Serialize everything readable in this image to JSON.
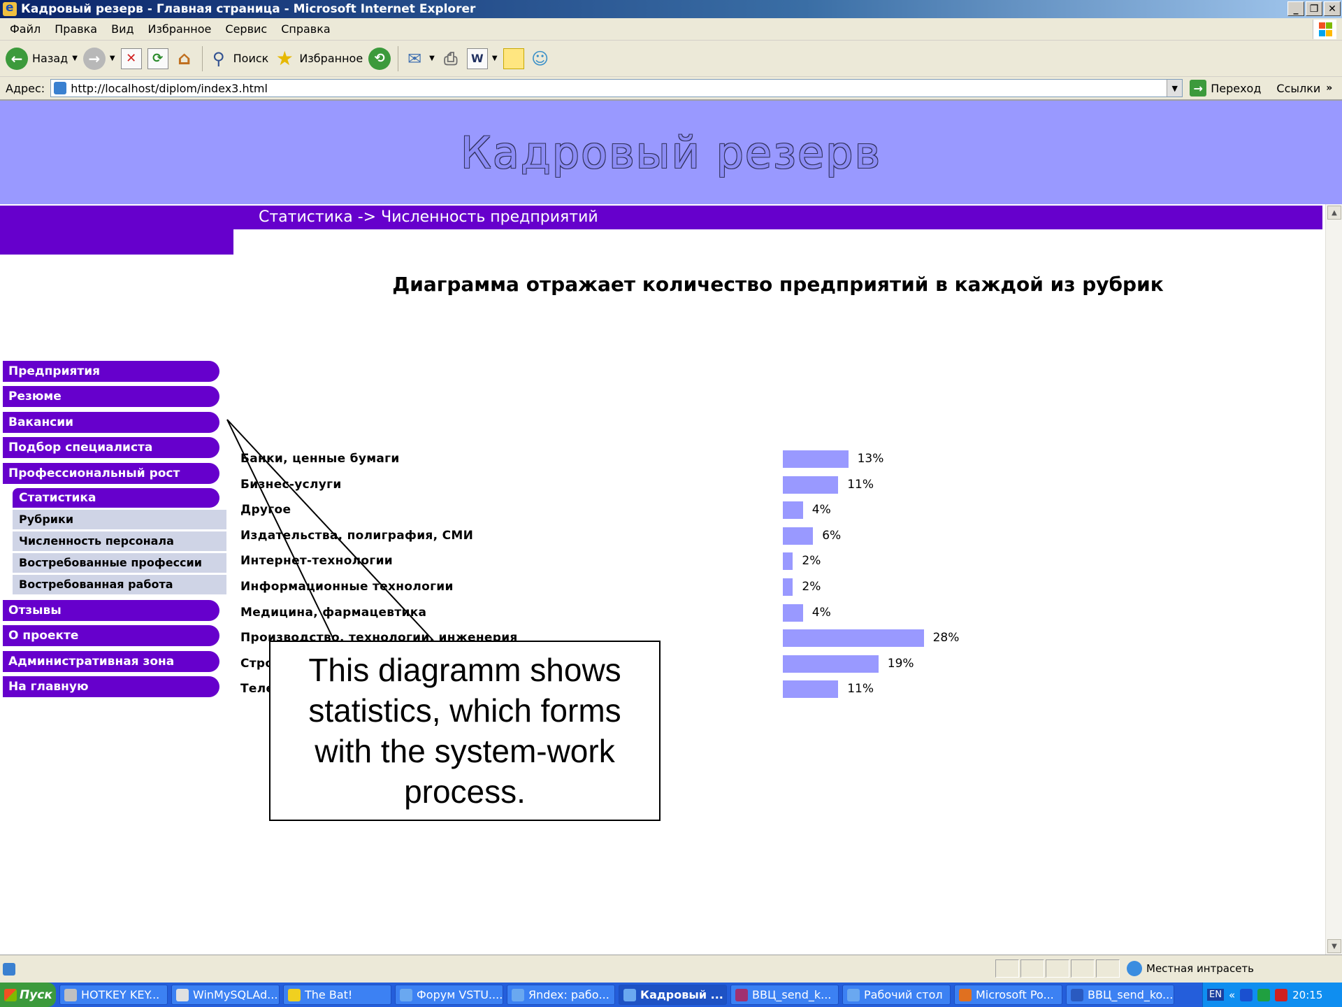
{
  "window": {
    "title": "Кадровый резерв - Главная страница - Microsoft Internet Explorer",
    "buttons": {
      "minimize": "_",
      "maximize": "❐",
      "close": "✕"
    }
  },
  "menu": [
    "Файл",
    "Правка",
    "Вид",
    "Избранное",
    "Сервис",
    "Справка"
  ],
  "toolbar": {
    "back": "Назад",
    "search": "Поиск",
    "favorites": "Избранное"
  },
  "address": {
    "label": "Адрес:",
    "url": "http://localhost/diplom/index3.html",
    "go": "Переход",
    "links": "Ссылки"
  },
  "page": {
    "banner_title": "Кадровый резерв",
    "breadcrumb": "Статистика -> Численность предприятий",
    "sidebar": {
      "items": [
        "Предприятия",
        "Резюме",
        "Вакансии",
        "Подбор специалиста",
        "Профессиональный рост"
      ],
      "active_sub": "Статистика",
      "subs": [
        "Рубрики",
        "Численность персонала",
        "Востребованные профессии",
        "Востребованная работа"
      ],
      "items_after": [
        "Отзывы",
        "О проекте",
        "Административная зона",
        "На главную"
      ]
    }
  },
  "chart_data": {
    "type": "bar",
    "orientation": "horizontal",
    "title": "Диаграмма отражает количество предприятий в каждой из рубрик",
    "categories": [
      "Банки, ценные бумаги",
      "Бизнес-услуги",
      "Другое",
      "Издательства, полиграфия, СМИ",
      "Интернет-технологии",
      "Информационные технологии",
      "Медицина, фармацевтика",
      "Производство, технологии, инженерия",
      "Строительство, недвижимость",
      "Телекоммуникации, связь"
    ],
    "values": [
      13,
      11,
      4,
      6,
      2,
      2,
      4,
      28,
      19,
      11
    ],
    "labels": [
      "13%",
      "11%",
      "4%",
      "6%",
      "2%",
      "2%",
      "4%",
      "28%",
      "19%",
      "11%"
    ],
    "unit": "%",
    "bar_color": "#9999ff"
  },
  "callout": {
    "text": "This diagramm shows statistics, which forms with the  system-work process."
  },
  "statusbar": {
    "zone": "Местная интрасеть"
  },
  "taskbar": {
    "start": "Пуск",
    "tasks": [
      "HOTKEY KEY...",
      "WinMySQLAd...",
      "The Bat!",
      "Форум VSTU....",
      "Яndex: рабо...",
      "Кадровый ...",
      "ВВЦ_send_k...",
      "Рабочий стол",
      "Microsoft Po...",
      "ВВЦ_send_ko..."
    ],
    "lang": "EN",
    "clock": "20:15"
  }
}
